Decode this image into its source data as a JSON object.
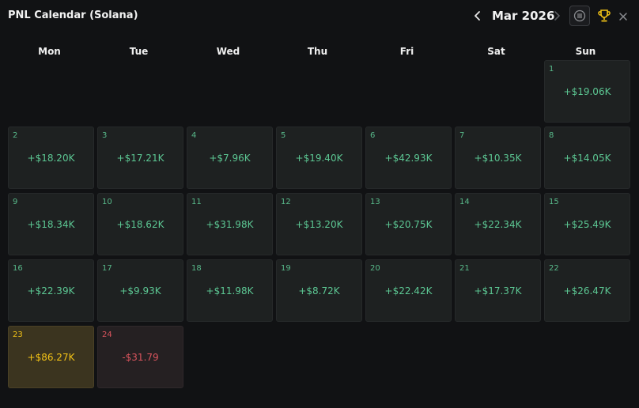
{
  "header": {
    "title": "PNL Calendar (Solana)",
    "month": "Mar 2026"
  },
  "weekdays": [
    "Mon",
    "Tue",
    "Wed",
    "Thu",
    "Fri",
    "Sat",
    "Sun"
  ],
  "days": [
    {
      "day": "1",
      "pnl": "+$19.06K",
      "status": "positive"
    },
    {
      "day": "2",
      "pnl": "+$18.20K",
      "status": "positive"
    },
    {
      "day": "3",
      "pnl": "+$17.21K",
      "status": "positive"
    },
    {
      "day": "4",
      "pnl": "+$7.96K",
      "status": "positive"
    },
    {
      "day": "5",
      "pnl": "+$19.40K",
      "status": "positive"
    },
    {
      "day": "6",
      "pnl": "+$42.93K",
      "status": "positive"
    },
    {
      "day": "7",
      "pnl": "+$10.35K",
      "status": "positive"
    },
    {
      "day": "8",
      "pnl": "+$14.05K",
      "status": "positive"
    },
    {
      "day": "9",
      "pnl": "+$18.34K",
      "status": "positive"
    },
    {
      "day": "10",
      "pnl": "+$18.62K",
      "status": "positive"
    },
    {
      "day": "11",
      "pnl": "+$31.98K",
      "status": "positive"
    },
    {
      "day": "12",
      "pnl": "+$13.20K",
      "status": "positive"
    },
    {
      "day": "13",
      "pnl": "+$20.75K",
      "status": "positive"
    },
    {
      "day": "14",
      "pnl": "+$22.34K",
      "status": "positive"
    },
    {
      "day": "15",
      "pnl": "+$25.49K",
      "status": "positive"
    },
    {
      "day": "16",
      "pnl": "+$22.39K",
      "status": "positive"
    },
    {
      "day": "17",
      "pnl": "+$9.93K",
      "status": "positive"
    },
    {
      "day": "18",
      "pnl": "+$11.98K",
      "status": "positive"
    },
    {
      "day": "19",
      "pnl": "+$8.72K",
      "status": "positive"
    },
    {
      "day": "20",
      "pnl": "+$22.42K",
      "status": "positive"
    },
    {
      "day": "21",
      "pnl": "+$17.37K",
      "status": "positive"
    },
    {
      "day": "22",
      "pnl": "+$26.47K",
      "status": "positive"
    },
    {
      "day": "23",
      "pnl": "+$86.27K",
      "status": "best"
    },
    {
      "day": "24",
      "pnl": "-$31.79",
      "status": "negative"
    }
  ],
  "colors": {
    "background": "#111214",
    "cell": "#1e2121",
    "positive": "#5cc793",
    "best": "#f3c316",
    "best_cell": "#3b341f",
    "negative": "#d9545d",
    "negative_cell": "#252022"
  },
  "icons": [
    "chevron-left-icon",
    "chevron-right-icon",
    "coin-icon",
    "trophy-icon",
    "close-icon"
  ]
}
